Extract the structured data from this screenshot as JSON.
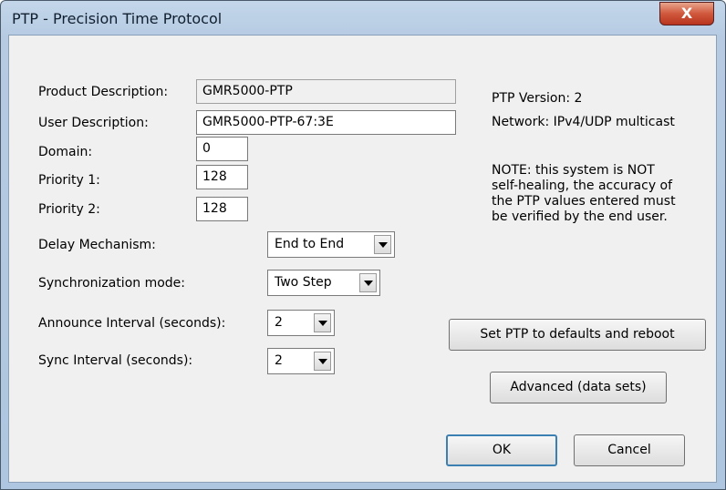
{
  "window": {
    "title": "PTP - Precision Time Protocol",
    "close_glyph": "X"
  },
  "form": {
    "product_description": {
      "label": "Product Description:",
      "value": "GMR5000-PTP"
    },
    "user_description": {
      "label": "User Description:",
      "value": "GMR5000-PTP-67:3E"
    },
    "domain": {
      "label": "Domain:",
      "value": "0"
    },
    "priority1": {
      "label": "Priority 1:",
      "value": "128"
    },
    "priority2": {
      "label": "Priority 2:",
      "value": "128"
    },
    "delay_mechanism": {
      "label": "Delay Mechanism:",
      "value": "End to End"
    },
    "sync_mode": {
      "label": "Synchronization mode:",
      "value": "Two Step"
    },
    "announce_interval": {
      "label": "Announce Interval (seconds):",
      "value": "2"
    },
    "sync_interval": {
      "label": "Sync Interval (seconds):",
      "value": "2"
    }
  },
  "info": {
    "ptp_version": "PTP Version: 2",
    "network": "Network: IPv4/UDP multicast",
    "note_lines": [
      "NOTE: this system is NOT",
      "self-healing, the accuracy of",
      "the PTP values entered must",
      "be verified by the end user."
    ]
  },
  "buttons": {
    "reset": "Set PTP to defaults and reboot",
    "advanced": "Advanced (data sets)",
    "ok": "OK",
    "cancel": "Cancel"
  },
  "icons": {
    "dropdown": "chevron-down-icon",
    "close": "close-icon"
  },
  "colors": {
    "titlebar": "#b9cee4",
    "close_button": "#c8452a",
    "dialog_bg": "#f0f0f0"
  }
}
